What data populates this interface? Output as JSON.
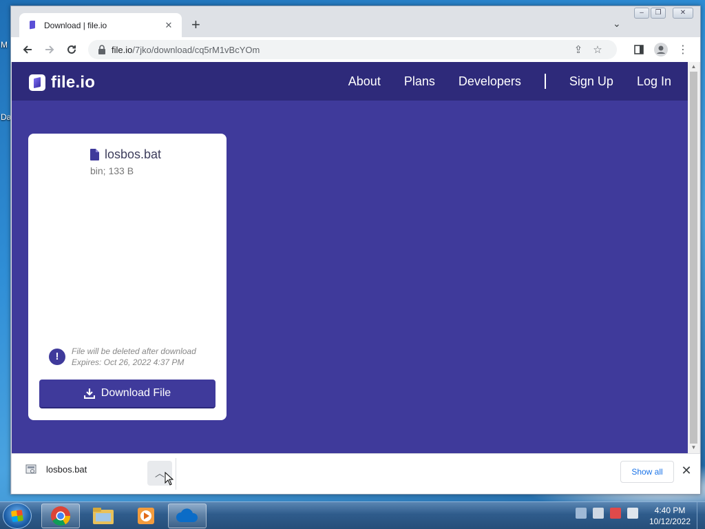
{
  "desktop": {
    "label_top": "M",
    "label_bottom": "Da"
  },
  "browser": {
    "tab": {
      "title": "Download | file.io",
      "favicon": "file-io-icon"
    },
    "url_host": "file.io",
    "url_path": "/7jko/download/cq5rM1vBcYOm",
    "window_controls": [
      "minimize",
      "restore",
      "close"
    ]
  },
  "site": {
    "logo_text": "file.io",
    "nav": [
      {
        "label": "About"
      },
      {
        "label": "Plans"
      },
      {
        "label": "Developers"
      },
      {
        "label": "Sign Up"
      },
      {
        "label": "Log In"
      }
    ],
    "colors": {
      "header": "#2e2a7a",
      "background": "#3f3a9b",
      "button": "#3f3a9b"
    }
  },
  "card": {
    "file_name": "losbos.bat",
    "file_meta": "bin; 133 B",
    "notice_line1": "File will be deleted after download",
    "notice_line2": "Expires: Oct 26, 2022 4:37 PM",
    "download_label": "Download File"
  },
  "shelf": {
    "file_name": "losbos.bat",
    "show_all_label": "Show all"
  },
  "taskbar": {
    "apps": [
      "chrome-icon",
      "file-explorer-icon",
      "media-player-icon",
      "onedrive-icon"
    ],
    "time": "4:40 PM",
    "date": "10/12/2022"
  }
}
